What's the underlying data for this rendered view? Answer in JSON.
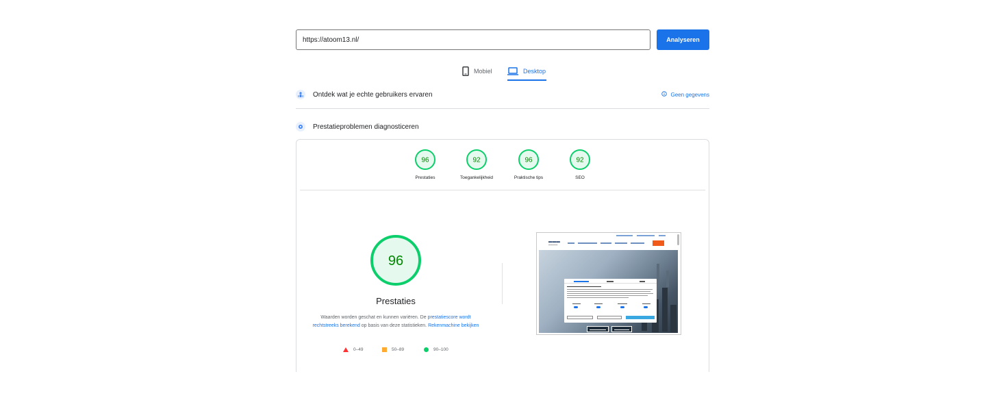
{
  "search": {
    "url_value": "https://atoom13.nl/",
    "analyze_label": "Analyseren"
  },
  "device_tabs": {
    "mobile_label": "Mobiel",
    "desktop_label": "Desktop",
    "selected": "Desktop"
  },
  "crux_section": {
    "title": "Ontdek wat je echte gebruikers ervaren",
    "no_data_label": "Geen gegevens"
  },
  "lab_section": {
    "title": "Prestatieproblemen diagnosticeren"
  },
  "categories": [
    {
      "score": "96",
      "label": "Prestaties"
    },
    {
      "score": "92",
      "label": "Toegankelijkheid"
    },
    {
      "score": "96",
      "label": "Praktische tips"
    },
    {
      "score": "92",
      "label": "SEO"
    }
  ],
  "performance": {
    "score": "96",
    "title": "Prestaties",
    "note_part1": "Waarden worden geschat en kunnen variëren. De ",
    "note_link1": "prestatiescore wordt rechtstreeks berekend",
    "note_part2": " op basis van deze statistieken. ",
    "note_link2": "Rekenmachine bekijken"
  },
  "legend": {
    "fail": "0–49",
    "average": "50–89",
    "pass": "90–100"
  },
  "colors": {
    "accent": "#1a73e8",
    "pass": "#0cce6b",
    "pass_text": "#008800",
    "pass_fill": "#e6f9ee",
    "average": "#ffaa33",
    "fail": "#ff3333"
  }
}
